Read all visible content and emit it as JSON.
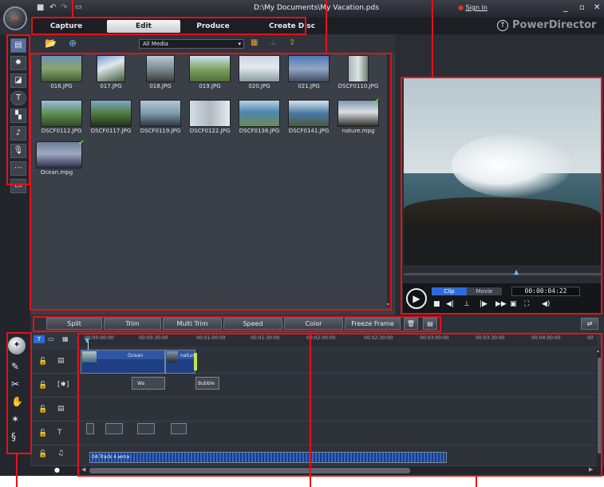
{
  "titlebar": {
    "doc_path": "D:\\My Documents\\My Vacation.pds",
    "sign_in": "Sign in",
    "brand": "PowerDirector",
    "minimize": "_",
    "restore": "▫",
    "close": "✕"
  },
  "nav": {
    "tabs": [
      {
        "label": "Capture"
      },
      {
        "label": "Edit"
      },
      {
        "label": "Produce"
      },
      {
        "label": "Create Disc"
      }
    ]
  },
  "library": {
    "filter": "All Media",
    "items": [
      {
        "name": "016.JPG",
        "checked": false
      },
      {
        "name": "017.JPG",
        "checked": false
      },
      {
        "name": "018.JPG",
        "checked": false
      },
      {
        "name": "019.JPG",
        "checked": false
      },
      {
        "name": "020.JPG",
        "checked": false
      },
      {
        "name": "021.JPG",
        "checked": false
      },
      {
        "name": "DSCF0110.JPG",
        "checked": false
      },
      {
        "name": "DSCF0112.JPG",
        "checked": false
      },
      {
        "name": "DSCF0117.JPG",
        "checked": false
      },
      {
        "name": "DSCF0119.JPG",
        "checked": false
      },
      {
        "name": "DSCF0122.JPG",
        "checked": false
      },
      {
        "name": "DSCF0138.JPG",
        "checked": false
      },
      {
        "name": "DSCF0141.JPG",
        "checked": false
      },
      {
        "name": "nature.mpg",
        "checked": true
      },
      {
        "name": "Ocean.mpg",
        "checked": true
      }
    ]
  },
  "preview": {
    "mode_clip": "Clip",
    "mode_movie": "Movie",
    "timecode": "00:00:04:22"
  },
  "edit_toolbar": {
    "split": "Split",
    "trim": "Trim",
    "multi_trim": "Multi Trim",
    "speed": "Speed",
    "color": "Color",
    "freeze_frame": "Freeze Frame"
  },
  "timeline": {
    "ticks": [
      "00:00:00:00",
      "00:00:30:00",
      "00:01:00:00",
      "00:01:30:00",
      "00:02:00:00",
      "00:02:30:00",
      "00:03:00:00",
      "00:03:30:00",
      "00:04:00:00",
      "00"
    ],
    "video_clips": [
      "Ocean",
      "nature"
    ],
    "effect_clips": [
      "Wa",
      "Bubble"
    ],
    "audio_clip": "04 Track 4.wma"
  },
  "colors": {
    "annotation": "#e8101a",
    "active_tab": "#f4f5f6",
    "accent_blue": "#2f6bd8",
    "check_green": "#65e045"
  }
}
